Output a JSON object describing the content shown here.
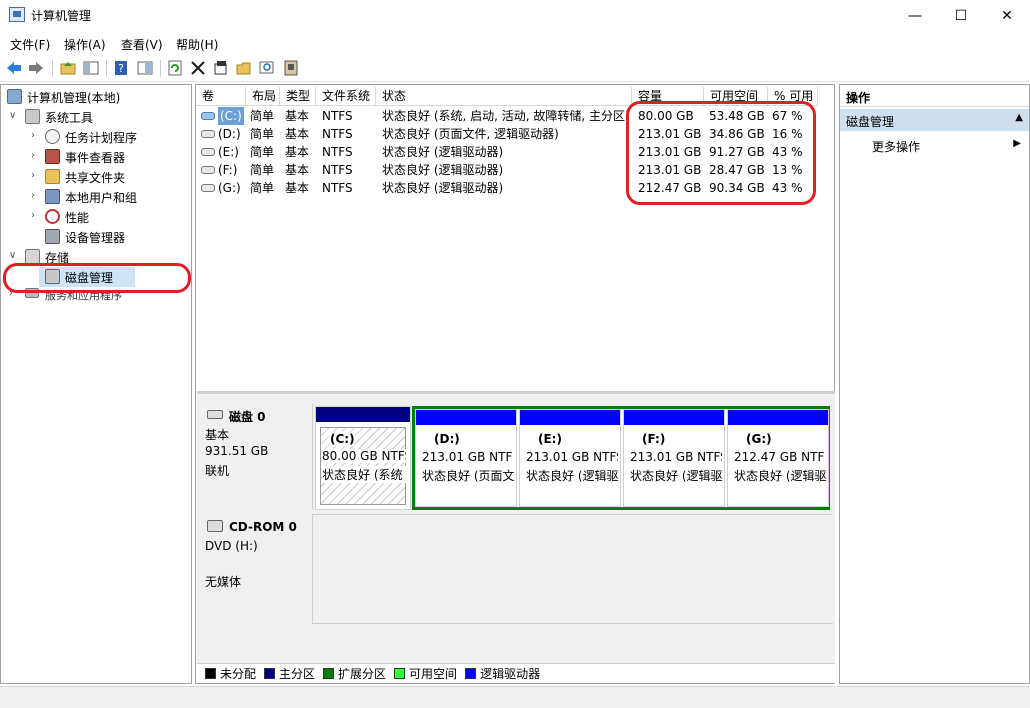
{
  "window": {
    "title": "计算机管理",
    "minimize": "—",
    "maximize": "☐",
    "close": "✕"
  },
  "menu": [
    "文件(F)",
    "操作(A)",
    "查看(V)",
    "帮助(H)"
  ],
  "tree": {
    "root": "计算机管理(本地)",
    "system_tools": "系统工具",
    "task_scheduler": "任务计划程序",
    "event_viewer": "事件查看器",
    "shared_folders": "共享文件夹",
    "local_users": "本地用户和组",
    "performance": "性能",
    "device_manager": "设备管理器",
    "storage": "存储",
    "disk_management": "磁盘管理",
    "services": "服务和应用程序"
  },
  "volumes": {
    "headers": [
      "卷",
      "布局",
      "类型",
      "文件系统",
      "状态",
      "容量",
      "可用空间",
      "% 可用"
    ],
    "rows": [
      {
        "vol": "(C:)",
        "layout": "简单",
        "type": "基本",
        "fs": "NTFS",
        "status": "状态良好 (系统, 启动, 活动, 故障转储, 主分区)",
        "capacity": "80.00 GB",
        "free": "53.48 GB",
        "pct": "67 %"
      },
      {
        "vol": "(D:)",
        "layout": "简单",
        "type": "基本",
        "fs": "NTFS",
        "status": "状态良好 (页面文件, 逻辑驱动器)",
        "capacity": "213.01 GB",
        "free": "34.86 GB",
        "pct": "16 %"
      },
      {
        "vol": "(E:)",
        "layout": "简单",
        "type": "基本",
        "fs": "NTFS",
        "status": "状态良好 (逻辑驱动器)",
        "capacity": "213.01 GB",
        "free": "91.27 GB",
        "pct": "43 %"
      },
      {
        "vol": "(F:)",
        "layout": "简单",
        "type": "基本",
        "fs": "NTFS",
        "status": "状态良好 (逻辑驱动器)",
        "capacity": "213.01 GB",
        "free": "28.47 GB",
        "pct": "13 %"
      },
      {
        "vol": "(G:)",
        "layout": "简单",
        "type": "基本",
        "fs": "NTFS",
        "status": "状态良好 (逻辑驱动器)",
        "capacity": "212.47 GB",
        "free": "90.34 GB",
        "pct": "43 %"
      }
    ]
  },
  "disk0": {
    "name": "磁盘 0",
    "type": "基本",
    "size": "931.51 GB",
    "state": "联机",
    "partitions": [
      {
        "label": "(C:)",
        "size": "80.00 GB NTFS",
        "status": "状态良好 (系统"
      },
      {
        "label": "(D:)",
        "size": "213.01 GB NTF",
        "status": "状态良好 (页面文"
      },
      {
        "label": "(E:)",
        "size": "213.01 GB NTFS",
        "status": "状态良好 (逻辑驱"
      },
      {
        "label": "(F:)",
        "size": "213.01 GB NTFS",
        "status": "状态良好 (逻辑驱"
      },
      {
        "label": "(G:)",
        "size": "212.47 GB NTF",
        "status": "状态良好 (逻辑驱"
      }
    ]
  },
  "cdrom": {
    "name": "CD-ROM 0",
    "drive": "DVD (H:)",
    "media": "无媒体"
  },
  "legend": [
    {
      "label": "未分配",
      "color": "#000000"
    },
    {
      "label": "主分区",
      "color": "#000080"
    },
    {
      "label": "扩展分区",
      "color": "#008000"
    },
    {
      "label": "可用空间",
      "color": "#33ff33"
    },
    {
      "label": "逻辑驱动器",
      "color": "#0000ff"
    }
  ],
  "actions": {
    "header": "操作",
    "section": "磁盘管理",
    "more": "更多操作"
  },
  "colors": {
    "highlight": "#e21d23",
    "primary": "#000080",
    "logical": "#0000ff",
    "extended": "#008000",
    "selected_bg": "#cce4f7"
  }
}
